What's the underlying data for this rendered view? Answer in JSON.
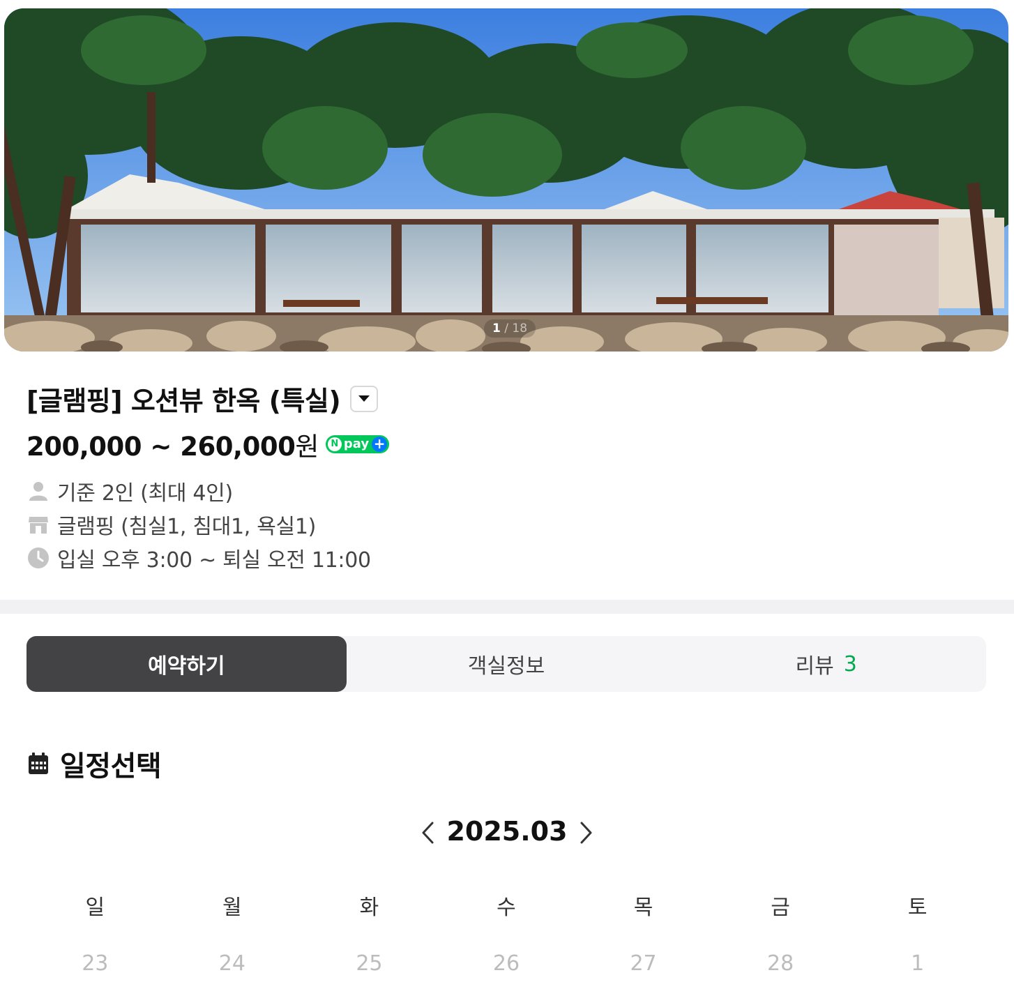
{
  "gallery": {
    "current": "1",
    "separator": " / ",
    "total": "18"
  },
  "room": {
    "title": "[글램핑] 오션뷰 한옥 (특실)",
    "price_range": "200,000 ~ 260,000",
    "price_unit": "원",
    "npay_label": "pay",
    "info": [
      {
        "icon": "person-icon",
        "text": "기준 2인 (최대 4인)"
      },
      {
        "icon": "building-icon",
        "text": "글램핑 (침실1, 침대1, 욕실1)"
      },
      {
        "icon": "clock-icon",
        "text": "입실 오후 3:00 ~ 퇴실 오전 11:00"
      }
    ]
  },
  "tabs": [
    {
      "label": "예약하기",
      "active": true
    },
    {
      "label": "객실정보",
      "active": false
    },
    {
      "label": "리뷰",
      "count": "3",
      "active": false
    }
  ],
  "schedule": {
    "title": "일정선택",
    "month": "2025.03",
    "weekdays": [
      "일",
      "월",
      "화",
      "수",
      "목",
      "금",
      "토"
    ],
    "first_week": [
      "23",
      "24",
      "25",
      "26",
      "27",
      "28",
      "1"
    ]
  },
  "colors": {
    "accent_green": "#03c75a",
    "tab_active": "#434245",
    "review_count": "#03a94e"
  }
}
